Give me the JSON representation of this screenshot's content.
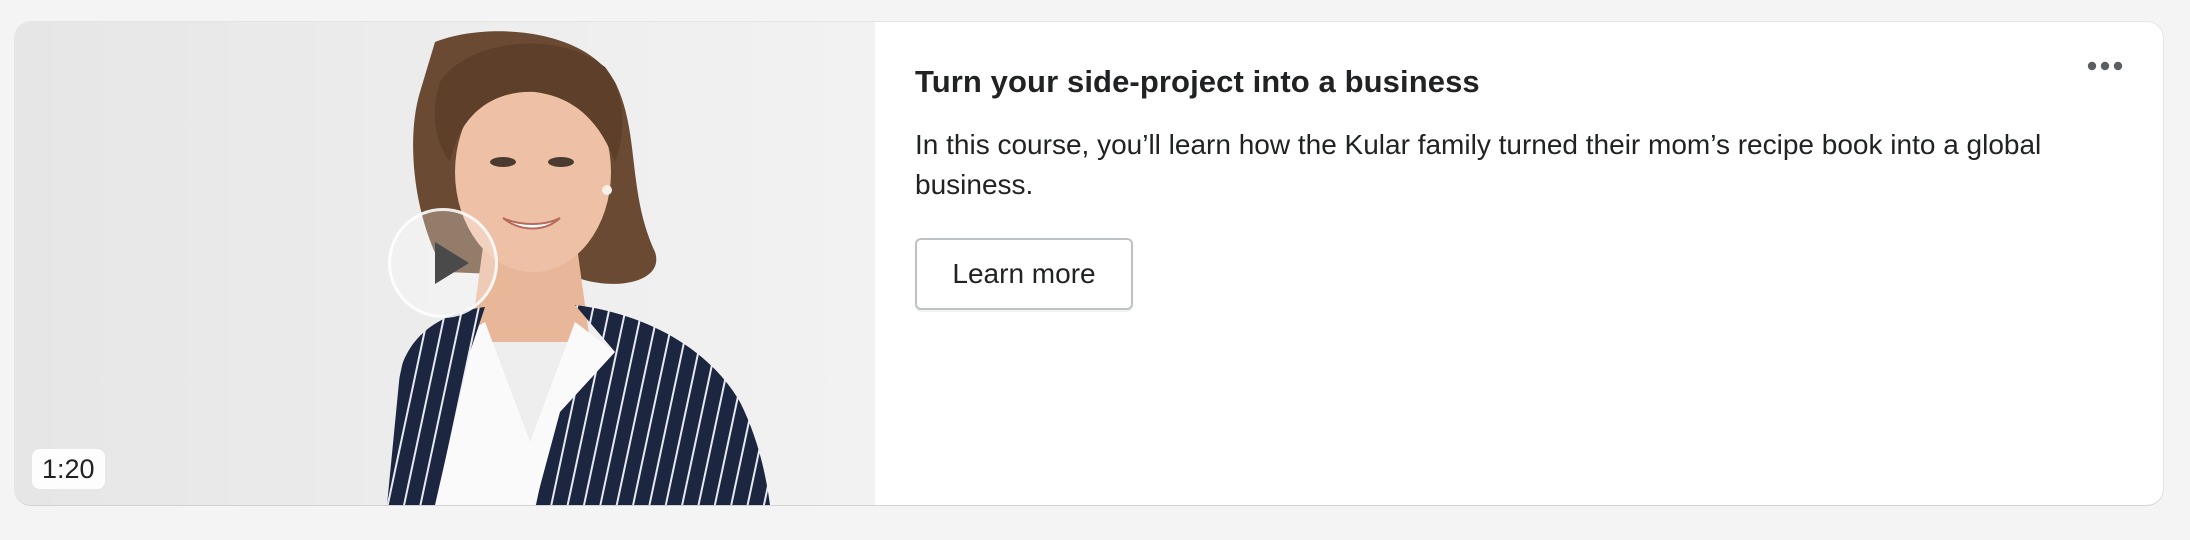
{
  "card": {
    "title": "Turn your side-project into a business",
    "description": "In this course, you’ll learn how the Kular family turned their mom’s recipe book into a global business.",
    "cta_label": "Learn more",
    "menu_icon": "more-horizontal-icon"
  },
  "video": {
    "duration": "1:20",
    "play_icon": "play-icon"
  },
  "colors": {
    "text": "#202223",
    "background": "#f4f4f4",
    "card": "#ffffff",
    "blazer": "#1c2640"
  }
}
